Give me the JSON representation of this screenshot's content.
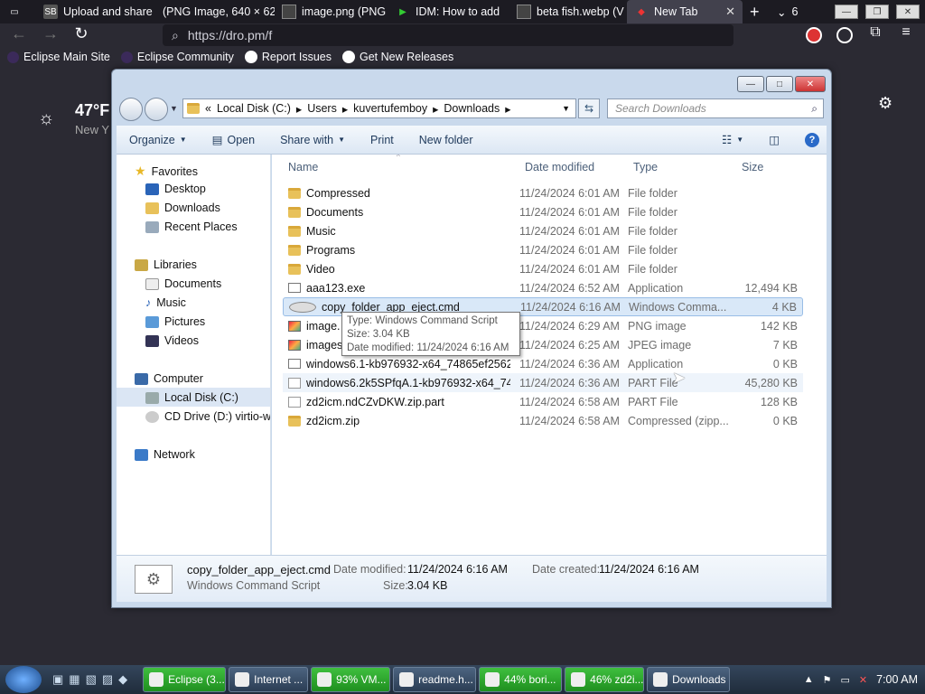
{
  "browser": {
    "tabs": [
      {
        "label": "",
        "icon": "tab-manager-icon"
      },
      {
        "label": "Upload and share",
        "icon": "sb-icon"
      },
      {
        "label": "(PNG Image, 640 × 62",
        "icon": "none"
      },
      {
        "label": "image.png (PNG",
        "icon": "image-icon"
      },
      {
        "label": "IDM: How to add",
        "icon": "idm-icon"
      },
      {
        "label": "beta fish.webp (V",
        "icon": "image-icon"
      },
      {
        "label": "New Tab",
        "icon": "firefox-icon"
      }
    ],
    "tab_count": "6",
    "url": "https://dro.pm/f",
    "bookmarks": [
      "Eclipse Main Site",
      "Eclipse Community",
      "Report Issues",
      "Get New Releases"
    ]
  },
  "weather": {
    "temp": "47°F",
    "location": "New Y"
  },
  "explorer": {
    "breadcrumb": [
      "Local Disk (C:)",
      "Users",
      "kuvertufemboy",
      "Downloads"
    ],
    "search_placeholder": "Search Downloads",
    "commands": [
      "Organize",
      "Open",
      "Share with",
      "Print",
      "New folder"
    ],
    "nav": {
      "favorites": "Favorites",
      "fav_items": [
        "Desktop",
        "Downloads",
        "Recent Places"
      ],
      "libraries": "Libraries",
      "lib_items": [
        "Documents",
        "Music",
        "Pictures",
        "Videos"
      ],
      "computer": "Computer",
      "comp_items": [
        "Local Disk (C:)",
        "CD Drive (D:) virtio-win"
      ],
      "network": "Network"
    },
    "columns": [
      "Name",
      "Date modified",
      "Type",
      "Size"
    ],
    "files": [
      {
        "name": "Compressed",
        "date": "11/24/2024 6:01 AM",
        "type": "File folder",
        "size": "",
        "kind": "folder"
      },
      {
        "name": "Documents",
        "date": "11/24/2024 6:01 AM",
        "type": "File folder",
        "size": "",
        "kind": "folder"
      },
      {
        "name": "Music",
        "date": "11/24/2024 6:01 AM",
        "type": "File folder",
        "size": "",
        "kind": "folder"
      },
      {
        "name": "Programs",
        "date": "11/24/2024 6:01 AM",
        "type": "File folder",
        "size": "",
        "kind": "folder"
      },
      {
        "name": "Video",
        "date": "11/24/2024 6:01 AM",
        "type": "File folder",
        "size": "",
        "kind": "folder"
      },
      {
        "name": "aaa123.exe",
        "date": "11/24/2024 6:52 AM",
        "type": "Application",
        "size": "12,494 KB",
        "kind": "exe"
      },
      {
        "name": "copy_folder_app_eject.cmd",
        "date": "11/24/2024 6:16 AM",
        "type": "Windows Comma...",
        "size": "4 KB",
        "kind": "cmd"
      },
      {
        "name": "image.",
        "date": "11/24/2024 6:29 AM",
        "type": "PNG image",
        "size": "142 KB",
        "kind": "img"
      },
      {
        "name": "images",
        "date": "11/24/2024 6:25 AM",
        "type": "JPEG image",
        "size": "7 KB",
        "kind": "img"
      },
      {
        "name": "windows6.1-kb976932-x64_74865ef25620...",
        "date": "11/24/2024 6:36 AM",
        "type": "Application",
        "size": "0 KB",
        "kind": "exe"
      },
      {
        "name": "windows6.2k5SPfqA.1-kb976932-x64_748...",
        "date": "11/24/2024 6:36 AM",
        "type": "PART File",
        "size": "45,280 KB",
        "kind": "page"
      },
      {
        "name": "zd2icm.ndCZvDKW.zip.part",
        "date": "11/24/2024 6:58 AM",
        "type": "PART File",
        "size": "128 KB",
        "kind": "page"
      },
      {
        "name": "zd2icm.zip",
        "date": "11/24/2024 6:58 AM",
        "type": "Compressed (zipp...",
        "size": "0 KB",
        "kind": "folder"
      }
    ],
    "tooltip": {
      "type": "Type: Windows Command Script",
      "size": "Size: 3.04 KB",
      "date": "Date modified: 11/24/2024 6:16 AM"
    },
    "details": {
      "name": "copy_folder_app_eject.cmd",
      "kind": "Windows Command Script",
      "date_modified_label": "Date modified:",
      "date_modified": "11/24/2024 6:16 AM",
      "size_label": "Size:",
      "size": "3.04 KB",
      "date_created_label": "Date created:",
      "date_created": "11/24/2024 6:16 AM"
    }
  },
  "taskbar": {
    "items": [
      {
        "label": "Eclipse (3...",
        "green": true
      },
      {
        "label": "Internet ...",
        "green": false
      },
      {
        "label": "93% VM...",
        "green": true
      },
      {
        "label": "readme.h...",
        "green": false
      },
      {
        "label": "44% bori...",
        "green": true
      },
      {
        "label": "46% zd2i...",
        "green": true
      },
      {
        "label": "Downloads",
        "green": false
      }
    ],
    "time": "7:00 AM"
  }
}
